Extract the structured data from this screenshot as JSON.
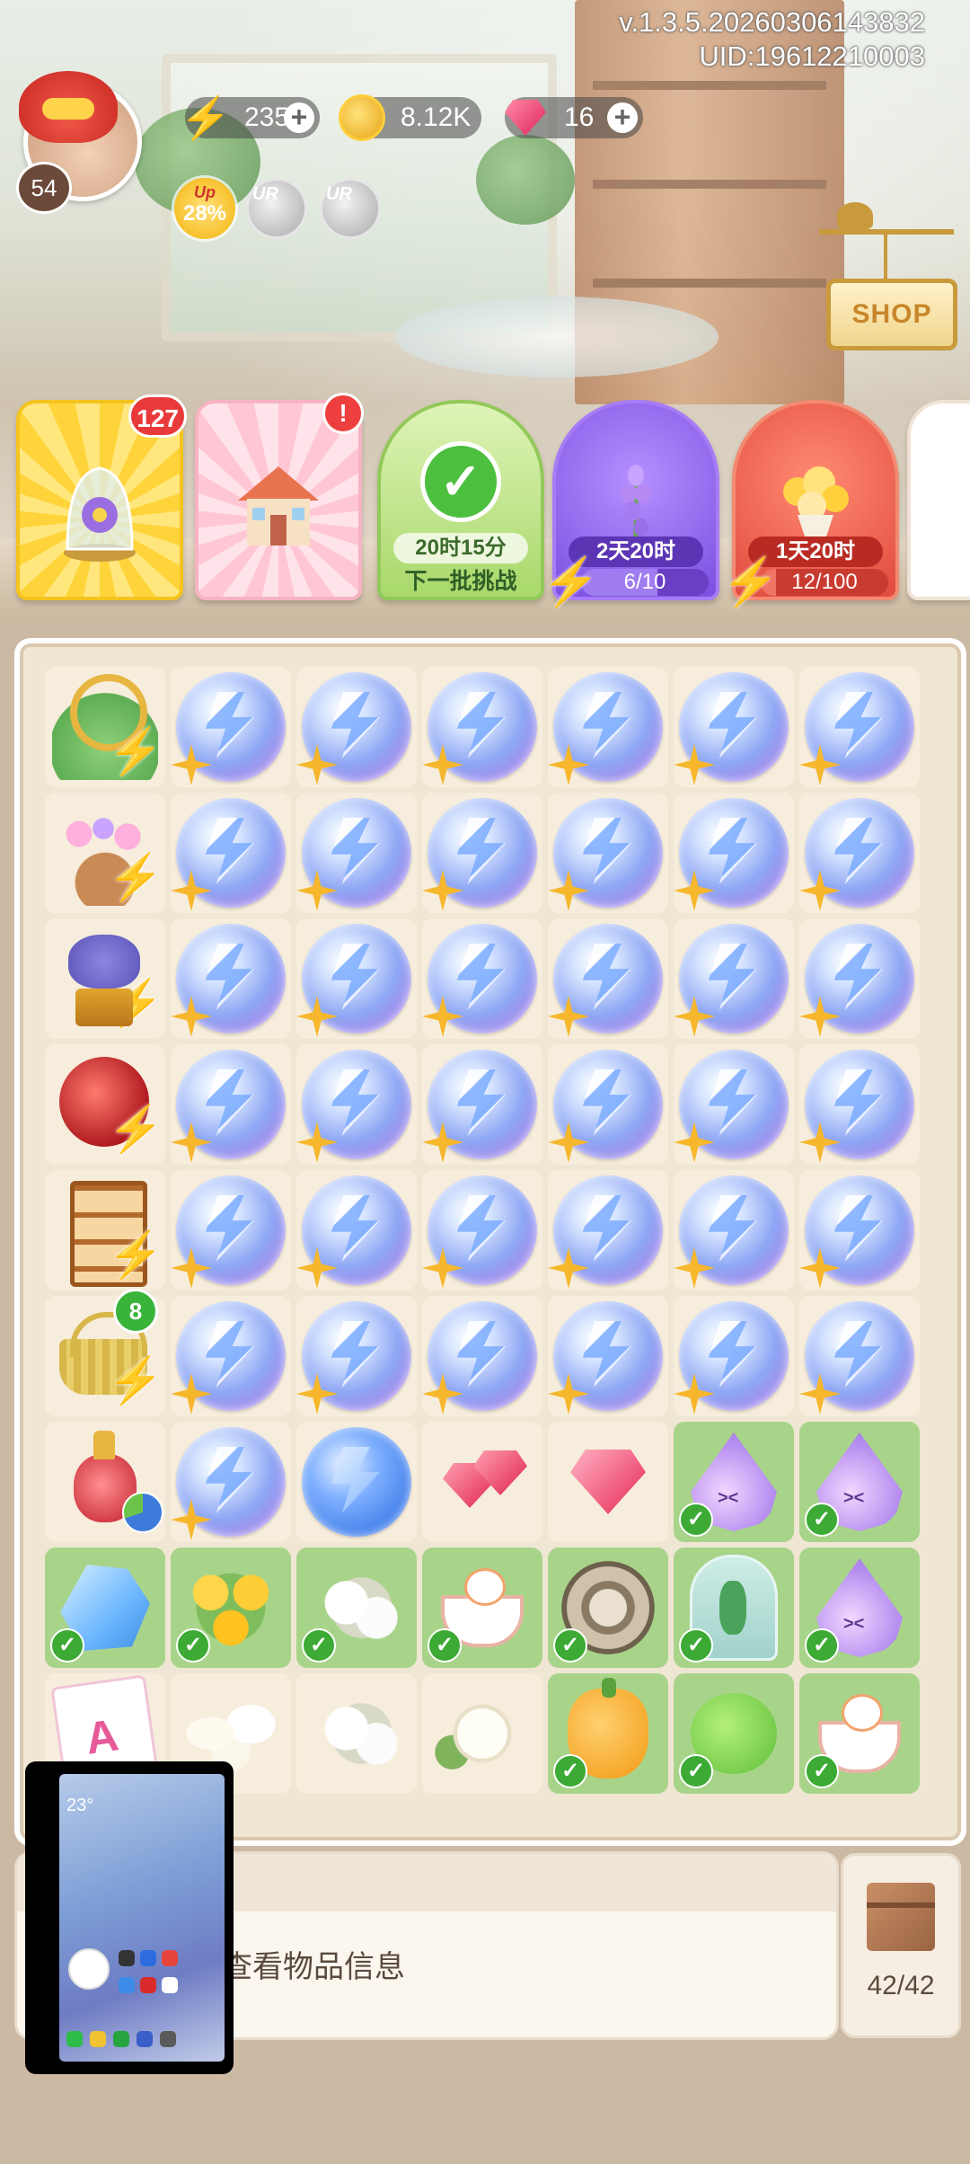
{
  "version": "v.1.3.5.20260306143832",
  "uid": "UID:19612210003",
  "player": {
    "level": "54"
  },
  "currency": {
    "energy": "235",
    "coins": "8.12K",
    "gems": "16",
    "plus": "+"
  },
  "boosts": {
    "up_label": "Up",
    "up_percent": "28%",
    "ur_label": "UR"
  },
  "shop_label": "SHOP",
  "event_cards": {
    "card1_badge": "127",
    "card2_badge": "!",
    "card3_timer": "20时15分",
    "card3_sub": "下一批挑战",
    "card4_timer": "2天20时",
    "card4_progress": "6/10",
    "card4_fraction": 0.6,
    "card5_timer": "1天20时",
    "card5_progress": "12/100",
    "card5_fraction": 0.12
  },
  "board": {
    "generator_badge_basket": "8",
    "check": "✓"
  },
  "info_text": "品可查看物品信息",
  "inventory_count": "42/42",
  "preview": {
    "temperature": "23°"
  },
  "colors": {
    "accent_green": "#3caa34",
    "badge_red": "#e83a3a",
    "energy_blue": "#5b9bff",
    "board_bg": "#f0e6d4"
  }
}
